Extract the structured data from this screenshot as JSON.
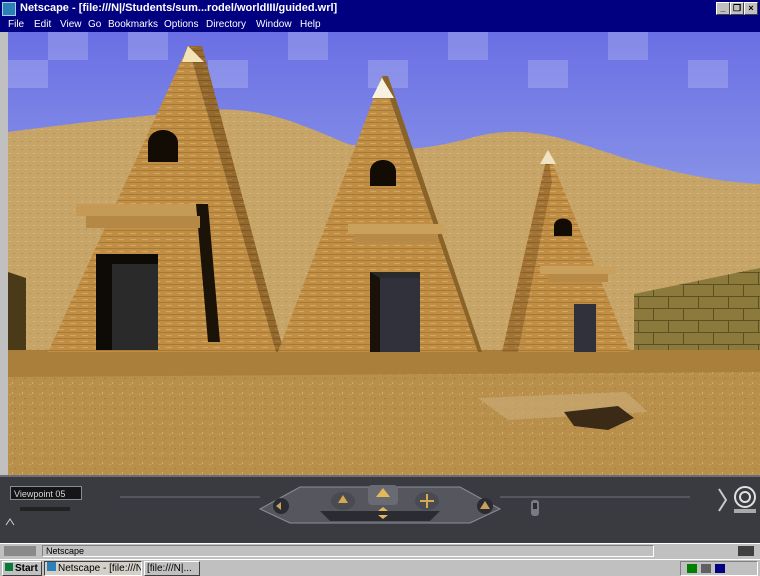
{
  "window": {
    "title": "Netscape - [file:///N|/Students/sum...rodel/worldIII/guided.wrl]",
    "controls": [
      "_",
      "❐",
      "×"
    ]
  },
  "menu": [
    "File",
    "Edit",
    "View",
    "Go",
    "Bookmarks",
    "Options",
    "Directory",
    "Window",
    "Help"
  ],
  "viewer": {
    "viewpoint_label": "Viewpoint 05",
    "nav_icons": [
      "scroll-left-icon",
      "turn-icon",
      "walk-icon",
      "slide-icon",
      "tilt-icon",
      "view-icon",
      "scroll-right-icon",
      "cosmo-logo-icon"
    ]
  },
  "status": {
    "text": "Netscape"
  },
  "taskbar": {
    "start_label": "Start",
    "buttons": [
      "Netscape - [file:///N|...",
      "[file:///N|..."
    ]
  },
  "colors": {
    "titlebar": "#000080",
    "sky": "#6f7fe0",
    "sand": "#b08b4a",
    "nav_panel": "#3a3b41"
  }
}
